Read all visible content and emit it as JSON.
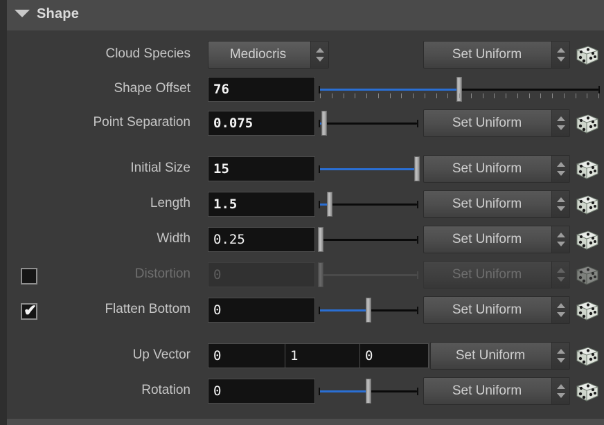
{
  "header": {
    "title": "Shape",
    "collapse_icon": "triangle-down-icon"
  },
  "common": {
    "set_uniform_label": "Set Uniform",
    "dice_icon": "dice-icon",
    "spinner_icon": "spinner-updown-icon"
  },
  "rows": [
    {
      "id": "cloud-species",
      "label": "Cloud Species",
      "control": "combo",
      "value": "Mediocris",
      "options": [
        "Mediocris"
      ],
      "set_uniform": "Set Uniform",
      "enabled": true
    },
    {
      "id": "shape-offset",
      "label": "Shape Offset",
      "control": "slider",
      "value": "76",
      "bold": true,
      "slider_pct": 50,
      "has_ticks": true,
      "set_uniform": null,
      "enabled": true
    },
    {
      "id": "point-separation",
      "label": "Point Separation",
      "control": "slider",
      "value": "0.075",
      "bold": true,
      "slider_pct": 4,
      "has_ticks": false,
      "set_uniform": "Set Uniform",
      "enabled": true
    },
    {
      "id": "initial-size",
      "label": "Initial Size",
      "control": "slider",
      "value": "15",
      "bold": true,
      "slider_pct": 100,
      "has_ticks": false,
      "set_uniform": "Set Uniform",
      "enabled": true
    },
    {
      "id": "length",
      "label": "Length",
      "control": "slider",
      "value": "1.5",
      "bold": true,
      "slider_pct": 10,
      "has_ticks": false,
      "set_uniform": "Set Uniform",
      "enabled": true
    },
    {
      "id": "width",
      "label": "Width",
      "control": "slider",
      "value": "0.25",
      "bold": false,
      "slider_pct": 1,
      "has_ticks": false,
      "set_uniform": "Set Uniform",
      "enabled": true
    },
    {
      "id": "distortion",
      "label": "Distortion",
      "control": "slider",
      "value": "0",
      "bold": false,
      "slider_pct": 1,
      "has_ticks": false,
      "set_uniform": "Set Uniform",
      "enabled": false,
      "checkbox": false
    },
    {
      "id": "flatten-bottom",
      "label": "Flatten Bottom",
      "control": "slider",
      "value": "0",
      "bold": false,
      "slider_pct": 50,
      "has_ticks": false,
      "set_uniform": "Set Uniform",
      "enabled": true,
      "checkbox": true,
      "check_glyph": "✔"
    },
    {
      "id": "up-vector",
      "label": "Up Vector",
      "control": "vector3",
      "values": [
        "0",
        "1",
        "0"
      ],
      "set_uniform": "Set Uniform",
      "enabled": true
    },
    {
      "id": "rotation",
      "label": "Rotation",
      "control": "slider",
      "value": "0",
      "bold": false,
      "slider_pct": 50,
      "has_ticks": false,
      "set_uniform": "Set Uniform",
      "enabled": true
    }
  ],
  "colors": {
    "accent_blue": "#2a6fd4",
    "panel_bg": "#3a3a3a",
    "header_bg": "#4a4a4a",
    "field_bg": "#121212"
  }
}
